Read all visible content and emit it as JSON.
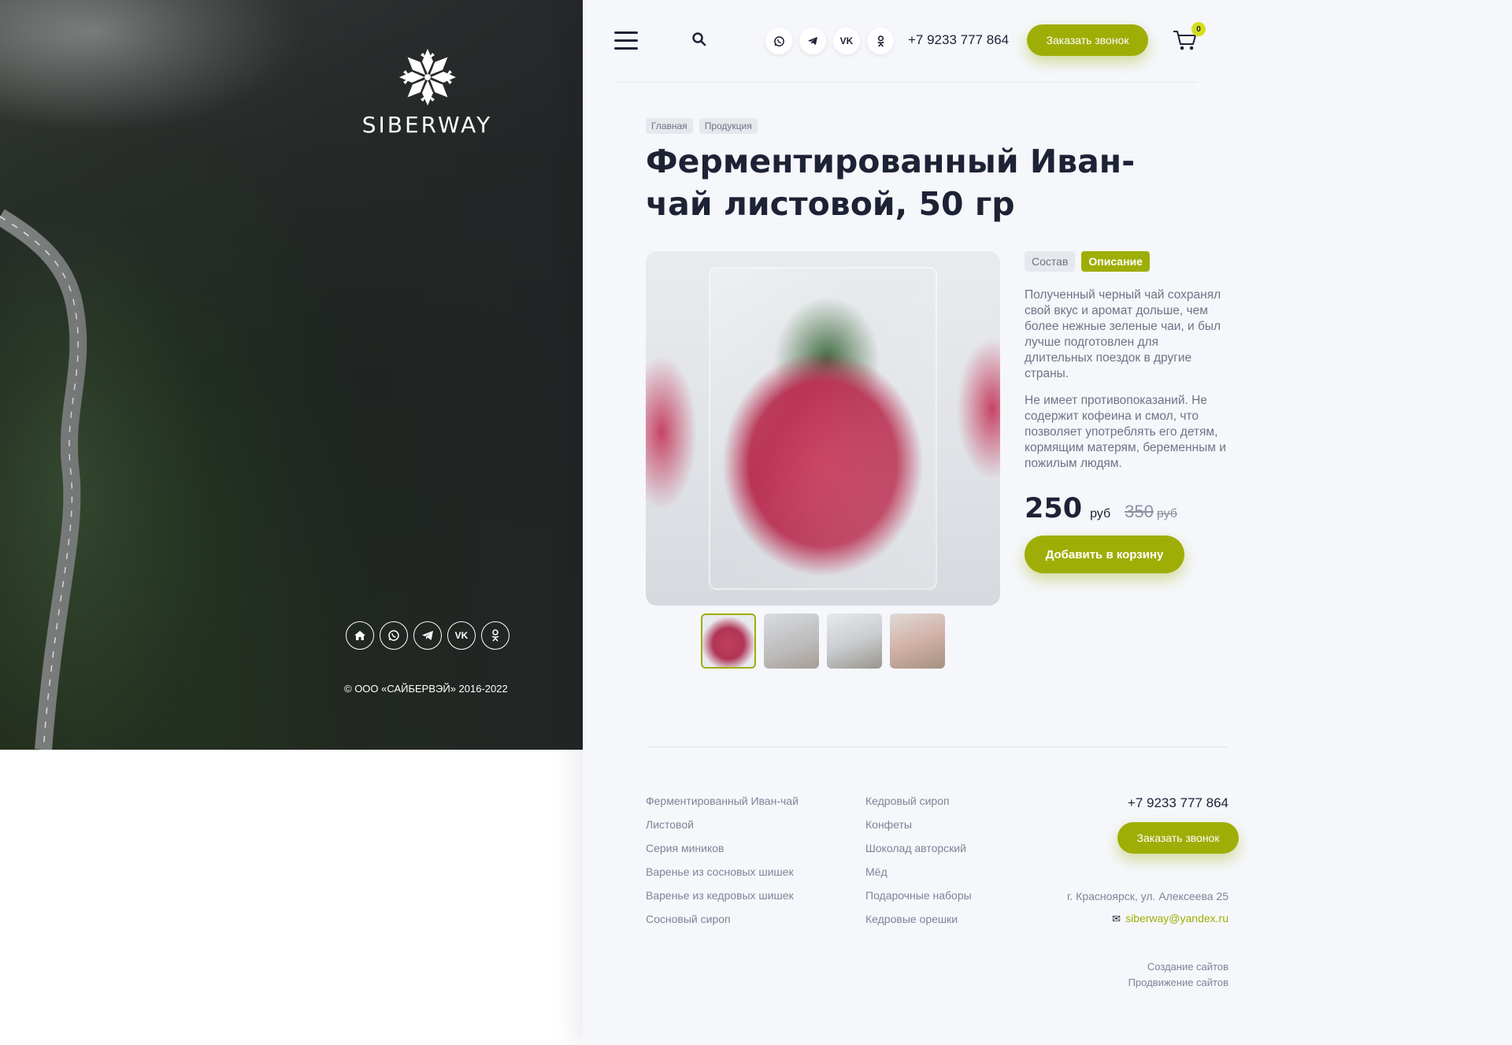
{
  "hero": {
    "brand": "SIBERWAY",
    "social": [
      "home-icon",
      "whatsapp-icon",
      "telegram-icon",
      "vk-icon",
      "odnoklassniki-icon"
    ],
    "copyright": "© ООО «САЙБЕРВЭЙ» 2016-2022"
  },
  "header": {
    "social": [
      "whatsapp-icon",
      "telegram-icon",
      "vk-icon",
      "odnoklassniki-icon"
    ],
    "phone": "+7 9233 777 864",
    "call_button": "Заказать звонок",
    "cart_count": "0"
  },
  "breadcrumbs": [
    "Главная",
    "Продукция"
  ],
  "product": {
    "title": "Ферментированный Иван-чай листовой, 50 гр",
    "tabs": [
      "Состав",
      "Описание"
    ],
    "active_tab": "Описание",
    "description": [
      "Полученный черный чай сохранял свой вкус и аромат дольше, чем более нежные зеленые чаи, и был лучше подготовлен для длительных поездок в другие страны.",
      "Не имеет противопоказаний. Не содержит кофеина и смол, что позволяет употреблять его детям, кормящим матерям, беременным и пожилым людям."
    ],
    "price": "250",
    "currency": "руб",
    "old_price": "350",
    "old_currency": "руб",
    "add_to_cart": "Добавить в корзину"
  },
  "footer": {
    "col1": [
      "Ферментированный Иван-чай",
      "Листовой",
      "Серия миников",
      "Варенье из сосновых шишек",
      "Варенье из кедровых шишек",
      "Сосновый сироп"
    ],
    "col2": [
      "Кедровый сироп",
      "Конфеты",
      "Шоколад авторский",
      "Мёд",
      "Подарочные наборы",
      "Кедровые орешки"
    ],
    "phone": "+7 9233 777 864",
    "call_button": "Заказать звонок",
    "address": "г. Красноярск, ул. Алексеева 25",
    "email": "siberway@yandex.ru",
    "credits": [
      "Создание сайтов",
      "Продвижение сайтов"
    ]
  },
  "colors": {
    "accent": "#9fae07",
    "text_dark": "#1e2235",
    "text_muted": "#7f8496",
    "background": "#f5f7fb"
  }
}
